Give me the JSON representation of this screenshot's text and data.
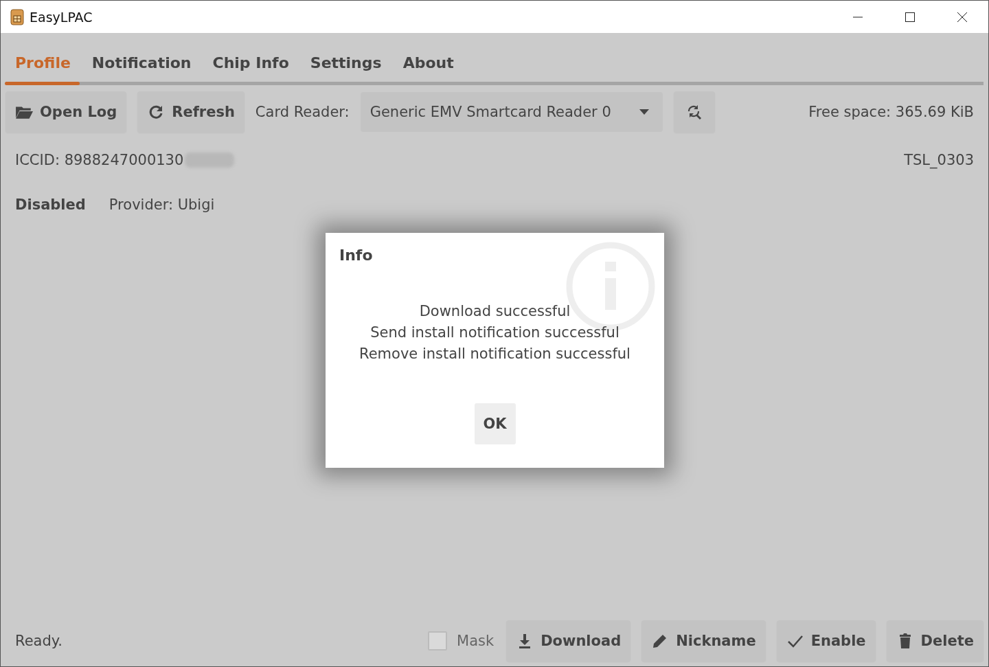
{
  "window": {
    "title": "EasyLPAC"
  },
  "tabs": [
    {
      "label": "Profile",
      "selected": true
    },
    {
      "label": "Notification",
      "selected": false
    },
    {
      "label": "Chip Info",
      "selected": false
    },
    {
      "label": "Settings",
      "selected": false
    },
    {
      "label": "About",
      "selected": false
    }
  ],
  "toolbar": {
    "buttons": [
      {
        "kind": "open-log",
        "label": "Open Log"
      },
      {
        "kind": "refresh",
        "label": "Refresh"
      }
    ],
    "card_reader_label": "Card Reader:",
    "card_reader": {
      "value": "Generic EMV Smartcard Reader 0"
    },
    "free_space": "Free space: 365.69 KiB"
  },
  "profile": {
    "iccid": "ICCID: 8988247000130",
    "redacted": true,
    "model": "TSL_0303",
    "status": "Disabled",
    "provider": "Provider: Ubigi"
  },
  "status_bar": {
    "text": "Ready.",
    "mask": {
      "label": "Mask",
      "checked": false,
      "disabled": true
    },
    "buttons": [
      {
        "kind": "download",
        "label": "Download"
      },
      {
        "kind": "nickname",
        "label": "Nickname"
      },
      {
        "kind": "enable",
        "label": "Enable"
      },
      {
        "kind": "delete",
        "label": "Delete"
      }
    ]
  },
  "dialog": {
    "title": "Info",
    "lines": [
      "Download successful",
      "Send install notification successful",
      "Remove install notification successful"
    ],
    "button": "OK"
  }
}
